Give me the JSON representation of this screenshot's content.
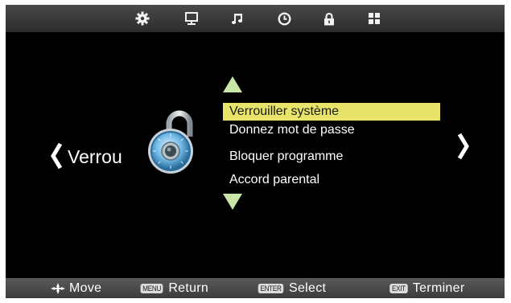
{
  "top_tabs": [
    {
      "icon": "gear-icon",
      "label": "settings"
    },
    {
      "icon": "monitor-icon",
      "label": "picture"
    },
    {
      "icon": "music-note-icon",
      "label": "sound"
    },
    {
      "icon": "clock-icon",
      "label": "time"
    },
    {
      "icon": "lock-icon",
      "label": "lock"
    },
    {
      "icon": "grid-icon",
      "label": "setup"
    }
  ],
  "menu": {
    "title": "Verrou",
    "items": [
      "Verrouiller système",
      "Donnez mot de passe",
      "Bloquer programme",
      "Accord parental"
    ],
    "selected_index": 0
  },
  "footer": {
    "move_label": "Move",
    "menu_key": "MENU",
    "return_label": "Return",
    "enter_key": "ENTER",
    "select_label": "Select",
    "exit_key": "EXIT",
    "exit_label": "Terminer"
  },
  "colors": {
    "background": "#000000",
    "highlight": "#e8e46a",
    "arrow_green": "#c8e6a8",
    "text": "#ffffff"
  }
}
